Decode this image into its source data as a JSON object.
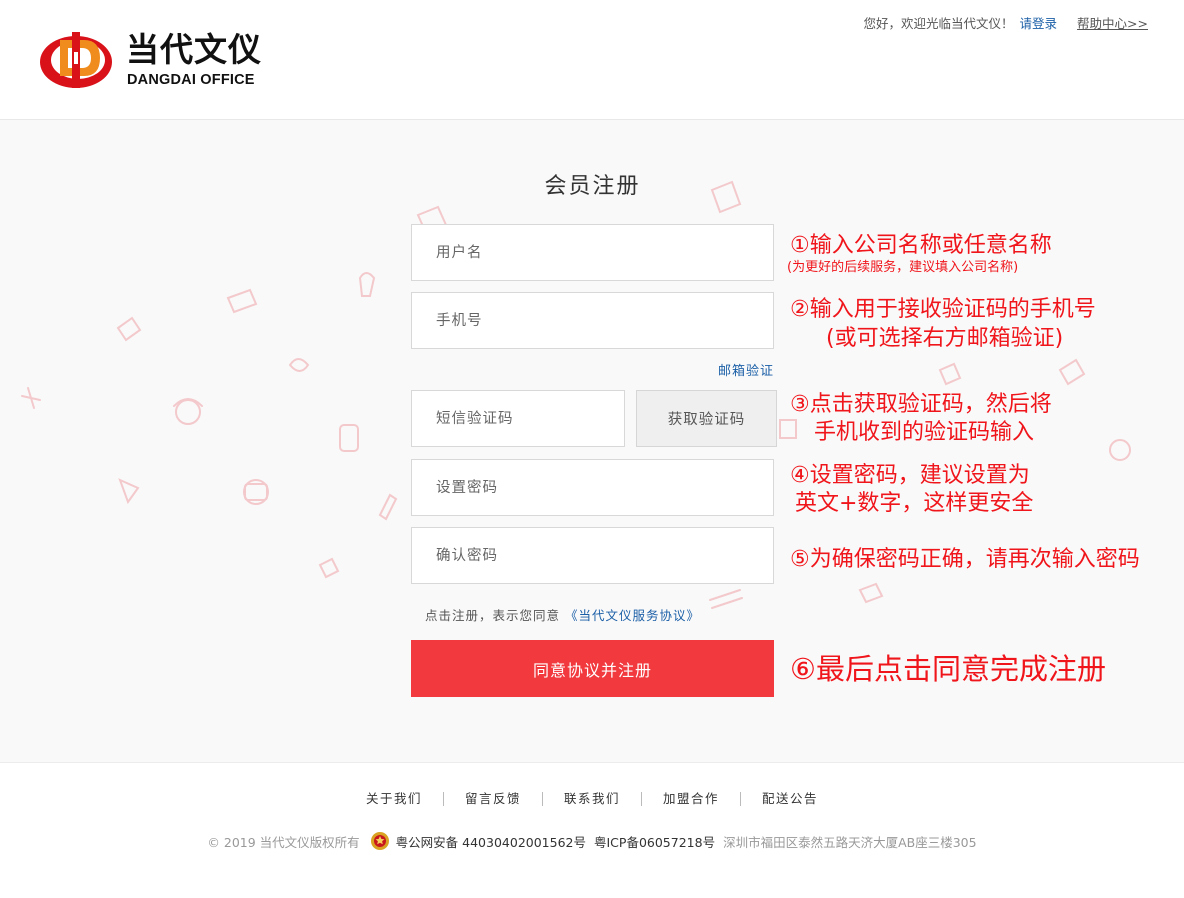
{
  "header": {
    "logo_cn": "当代文仪",
    "logo_en": "DANGDAI OFFICE",
    "welcome": "您好，欢迎光临当代文仪！",
    "login_link": "请登录",
    "help_link": "帮助中心>>"
  },
  "form": {
    "title": "会员注册",
    "username_placeholder": "用户名",
    "phone_placeholder": "手机号",
    "email_verify_link": "邮箱验证",
    "sms_code_placeholder": "短信验证码",
    "get_code_button": "获取验证码",
    "password_placeholder": "设置密码",
    "confirm_password_placeholder": "确认密码",
    "agree_text": "点击注册，表示您同意",
    "agree_link": "《当代文仪服务协议》",
    "submit_button": "同意协议并注册"
  },
  "annotations": {
    "step1": "①输入公司名称或任意名称",
    "step1_sub": "(为更好的后续服务，建议填入公司名称)",
    "step2_line1": "②输入用于接收验证码的手机号",
    "step2_line2": "(或可选择右方邮箱验证)",
    "step3_line1": "③点击获取验证码，然后将",
    "step3_line2": "手机收到的验证码输入",
    "step4_line1": "④设置密码，建议设置为",
    "step4_line2": "英文+数字，这样更安全",
    "step5": "⑤为确保密码正确，请再次输入密码",
    "step6": "⑥最后点击同意完成注册",
    "color": "#f0151b"
  },
  "footer": {
    "links": [
      "关于我们",
      "留言反馈",
      "联系我们",
      "加盟合作",
      "配送公告"
    ],
    "copyright": "© 2019 当代文仪版权所有",
    "police_record": "粤公网安备 44030402001562号",
    "icp": "粤ICP备06057218号",
    "address": "深圳市福田区泰然五路天济大厦AB座三楼305"
  },
  "colors": {
    "accent_red": "#f1393e",
    "link_blue": "#1b5fa7"
  }
}
